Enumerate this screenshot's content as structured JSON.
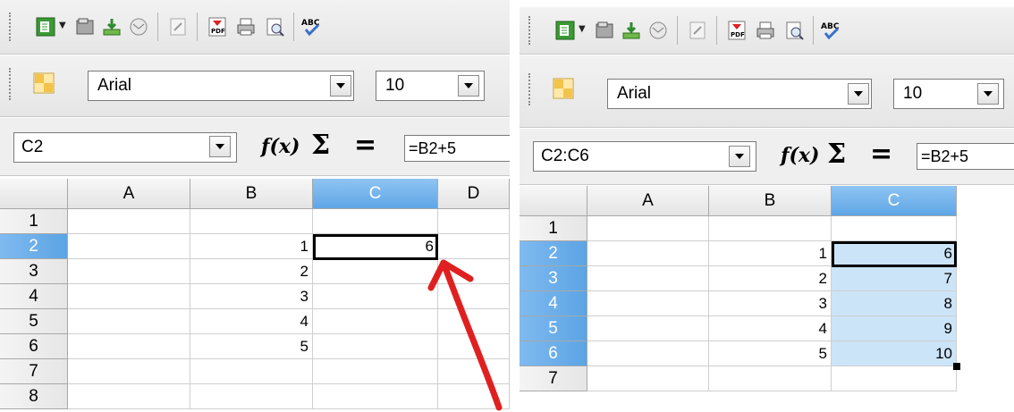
{
  "colors": {
    "accent_header": "#5fa6e6",
    "selection_fill": "#cce4f8",
    "annotation_arrow": "#e02020"
  },
  "before": {
    "font": {
      "name": "Arial",
      "size": "10"
    },
    "name_box": "C2",
    "formula": "=B2+5",
    "columns": [
      "A",
      "B",
      "C",
      "D"
    ],
    "rows": [
      "1",
      "2",
      "3",
      "4",
      "5",
      "6",
      "7",
      "8"
    ],
    "cells": {
      "B2": "1",
      "B3": "2",
      "B4": "3",
      "B5": "4",
      "B6": "5",
      "C2": "6"
    }
  },
  "after": {
    "font": {
      "name": "Arial",
      "size": "10"
    },
    "name_box": "C2:C6",
    "formula": "=B2+5",
    "columns": [
      "A",
      "B",
      "C"
    ],
    "rows": [
      "1",
      "2",
      "3",
      "4",
      "5",
      "6",
      "7"
    ],
    "cells": {
      "B2": "1",
      "B3": "2",
      "B4": "3",
      "B5": "4",
      "B6": "5",
      "C2": "6",
      "C3": "7",
      "C4": "8",
      "C5": "9",
      "C6": "10"
    }
  },
  "toolbar_icons": [
    "new-document-icon",
    "open-icon",
    "save-icon",
    "email-icon",
    "edit-file-icon",
    "export-pdf-icon",
    "print-icon",
    "page-preview-icon",
    "spellcheck-icon"
  ],
  "formula_icons": [
    "function-wizard-icon",
    "sum-icon",
    "formula-icon"
  ],
  "symbols": {
    "function_wizard": "f(x)",
    "sum": "Σ",
    "equals": "="
  }
}
